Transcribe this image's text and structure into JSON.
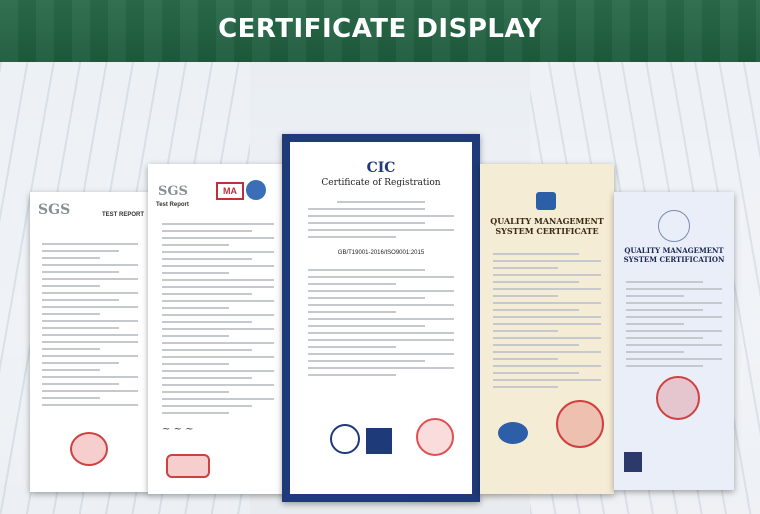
{
  "banner": {
    "title": "CERTIFICATE DISPLAY"
  },
  "certificates": [
    {
      "issuer": "SGS",
      "title": "TEST REPORT"
    },
    {
      "issuer": "SGS",
      "title": "Test Report",
      "mark": "MA"
    },
    {
      "issuer": "CIC",
      "title": "Certificate of Registration",
      "standard": "GB/T19001-2016/ISO9001:2015"
    },
    {
      "title": "QUALITY MANAGEMENT SYSTEM CERTIFICATE"
    },
    {
      "title": "QUALITY MANAGEMENT SYSTEM CERTIFICATION"
    }
  ]
}
